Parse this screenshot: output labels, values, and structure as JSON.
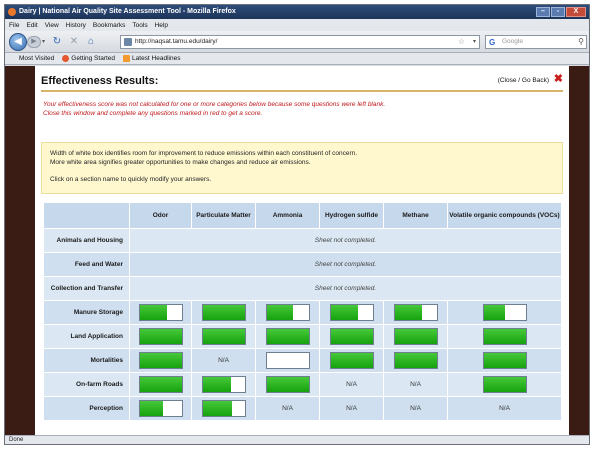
{
  "window": {
    "title": "Dairy | National Air Quality Site Assessment Tool - Mozilla Firefox",
    "controls": [
      "–",
      "▫",
      "X"
    ]
  },
  "menu": [
    "File",
    "Edit",
    "View",
    "History",
    "Bookmarks",
    "Tools",
    "Help"
  ],
  "nav": {
    "url": "http://naqsat.tamu.edu/dairy/",
    "search_placeholder": "Google"
  },
  "bookmarks": [
    "Most Visited",
    "Getting Started",
    "Latest Headlines"
  ],
  "page": {
    "title": "Effectiveness Results:",
    "close_link": "(Close / Go Back)",
    "warning_line1": "Your effectiveness score was not calculated for one or more categories below because some questions were left blank.",
    "warning_line2": "Close this window and complete any questions marked in red to get a score.",
    "info_line1": "Width of white box identifies room for improvement to reduce emissions within each constituent of concern.",
    "info_line2": "More white area signifies greater opportunities to make changes and reduce air emissions.",
    "info_line3": "Click on a section name to quickly modify your answers."
  },
  "table": {
    "columns": [
      "Odor",
      "Particulate Matter",
      "Ammonia",
      "Hydrogen sulfide",
      "Methane",
      "Volatile organic compounds (VOCs)"
    ],
    "not_completed_text": "Sheet not completed.",
    "rows": [
      {
        "name": "Animals and Housing",
        "incomplete": true
      },
      {
        "name": "Feed and Water",
        "incomplete": true
      },
      {
        "name": "Collection and Transfer",
        "incomplete": true
      },
      {
        "name": "Manure Storage",
        "incomplete": false,
        "cells": [
          0.65,
          1.0,
          0.62,
          0.65,
          0.65,
          0.5
        ]
      },
      {
        "name": "Land Application",
        "incomplete": false,
        "cells": [
          1.0,
          1.0,
          1.0,
          1.0,
          1.0,
          1.0
        ]
      },
      {
        "name": "Mortalities",
        "incomplete": false,
        "cells": [
          1.0,
          "N/A",
          0.0,
          1.0,
          1.0,
          1.0
        ]
      },
      {
        "name": "On-farm Roads",
        "incomplete": false,
        "cells": [
          1.0,
          0.68,
          1.0,
          "N/A",
          "N/A",
          1.0
        ]
      },
      {
        "name": "Perception",
        "incomplete": false,
        "cells": [
          0.55,
          0.7,
          "N/A",
          "N/A",
          "N/A",
          "N/A"
        ]
      }
    ]
  },
  "status": "Done",
  "colors": {
    "fill_green": "#1fae16",
    "header_blue": "#c5d8ec",
    "warning_red": "#c0171a",
    "info_bg": "#fff8cf"
  }
}
